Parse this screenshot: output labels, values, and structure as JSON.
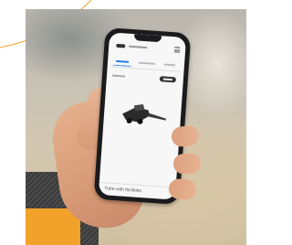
{
  "photo": {
    "subject": "hand holding smartphone showing app",
    "colors": {
      "sleeve_accent": "#f2a12a",
      "tab_accent": "#2a7de1",
      "deco_line": "#f2a12a"
    }
  },
  "phone_screen": {
    "footer_text": "Tube with facilities",
    "icons": [
      "menu-icon",
      "logo-mark",
      "machine-product-image"
    ]
  }
}
